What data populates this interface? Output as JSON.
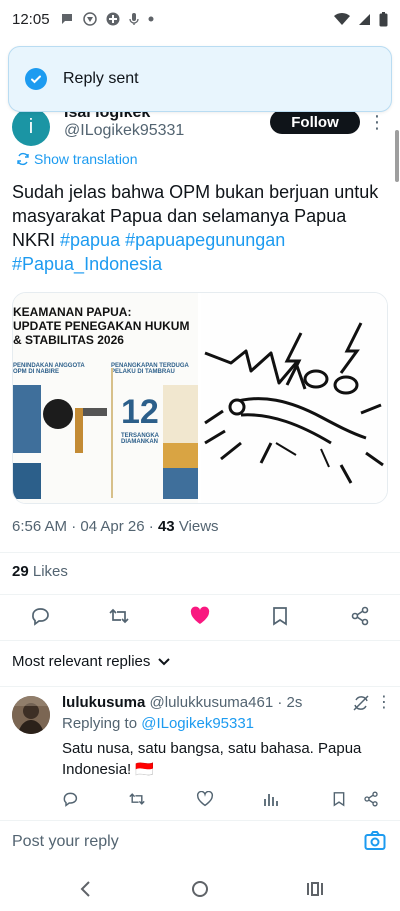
{
  "status_bar": {
    "time": "12:05",
    "icons": [
      "chat-bubble-icon",
      "vpn-icon",
      "pinwheel-icon",
      "mic-icon",
      "dot-icon"
    ],
    "right_icons": [
      "wifi-icon",
      "signal-icon",
      "battery-icon"
    ]
  },
  "toast": {
    "message": "Reply sent",
    "icon": "check-circle-icon"
  },
  "tweet": {
    "author_name": "Isai logikek",
    "author_handle": "@ILogikek95331",
    "follow_label": "Follow",
    "show_translation": "Show translation",
    "text_plain": "Sudah jelas bahwa OPM bukan berjuan untuk masyarakat Papua dan selamanya Papua NKRI ",
    "hashtags": [
      "#papua",
      "#papuapegunungan",
      "#Papua_Indonesia"
    ],
    "media": {
      "left_title_1": "KEAMANAN PAPUA:",
      "left_title_2": "UPDATE PENEGAKAN HUKUM",
      "left_title_3": "& STABILITAS 2026",
      "left_section_1": "PENINDAKAN ANGGOTA OPM DI NABIRE",
      "left_section_2": "PENANGKAPAN TERDUGA PELAKU DI TAMBRAU",
      "left_big_number": "12",
      "left_big_caption": "TERSANGKA DIAMANKAN"
    },
    "time": "6:56 AM",
    "date": "04 Apr 26",
    "views_count": "43",
    "views_label": "Views",
    "likes_count": "29",
    "likes_label": "Likes"
  },
  "actions": {
    "reply": "reply-icon",
    "retweet": "retweet-icon",
    "like": "heart-filled-icon",
    "bookmark": "bookmark-icon",
    "share": "share-icon",
    "like_color": "#f91880"
  },
  "replies_filter": {
    "label": "Most relevant replies"
  },
  "reply": {
    "name": "lulukusuma",
    "handle": "@lulukkusuma461",
    "time": "2s",
    "replying_prefix": "Replying to ",
    "replying_to": "@ILogikek95331",
    "text": "Satu nusa, satu bangsa, satu bahasa. Papua Indonesia! 🇮🇩"
  },
  "composer": {
    "placeholder": "Post your reply"
  },
  "colors": {
    "accent": "#1d9bf0",
    "text": "#0f1419",
    "muted": "#536471"
  }
}
